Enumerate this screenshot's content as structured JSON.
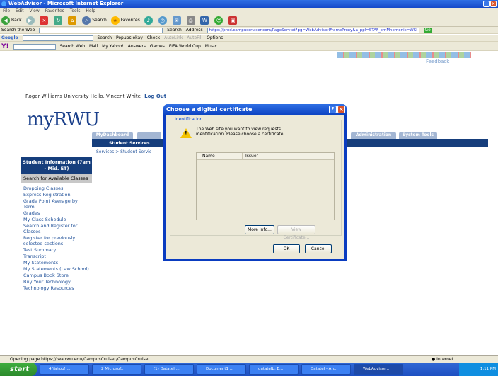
{
  "window": {
    "title": "WebAdvisor - Microsoft Internet Explorer"
  },
  "menu": [
    "File",
    "Edit",
    "View",
    "Favorites",
    "Tools",
    "Help"
  ],
  "toolbar": {
    "back": "Back",
    "search": "Search",
    "favorites": "Favorites"
  },
  "searchbar": {
    "label": "Search the Web",
    "search_btn": "Search",
    "address_label": "Address",
    "url": "https://prod.campuscruiser.com/PageServlet?pg=WebAdvisorIFrameProxy&a_ppl=STAF_cmMnemonic=WSI",
    "go": "Go"
  },
  "googlebar": {
    "logo": "Google",
    "search": "Search",
    "popups": "Popups okay",
    "check": "Check",
    "autolink": "AutoLink",
    "autofill": "AutoFill",
    "options": "Options"
  },
  "yahoobar": {
    "logo": "Y!",
    "search_web": "Search Web",
    "mail": "Mail",
    "my_yahoo": "My Yahoo!",
    "answers": "Answers",
    "games": "Games",
    "fifa": "FIFA World Cup",
    "music": "Music"
  },
  "header": {
    "university": "Roger Williams University",
    "greeting": "Hello, Vincent White",
    "logout": "Log Out",
    "feedback": "Feedback",
    "logo": "myRWU"
  },
  "tabs": [
    "MyDashboard",
    "Administration",
    "System Tools"
  ],
  "subbar": {
    "student_services": "Student Services",
    "breadcrumb": "Services > Student Servic"
  },
  "sidebar": {
    "heading": "Student Information (7am - Mid. ET)",
    "selected": "Search for Available Classes",
    "links": [
      "Dropping Classes",
      "Express Registration",
      "Grade Point Average by Term",
      "Grades",
      "My Class Schedule",
      "Search and Register for Classes",
      "Register for previously selected sections",
      "Test Summary",
      "Transcript",
      "My Statements",
      "My Statements (Law School)",
      "Campus Book Store",
      "Buy Your Technology",
      "Technology Resources"
    ]
  },
  "dialog": {
    "title": "Choose a digital certificate",
    "group": "Identification",
    "message": "The Web site you want to view requests identification. Please choose a certificate.",
    "col_name": "Name",
    "col_issuer": "Issuer",
    "more_info": "More Info...",
    "view_cert": "View Certificate...",
    "ok": "OK",
    "cancel": "Cancel"
  },
  "status": {
    "text": "Opening page https://iwa.rwu.edu/CampusCruiser/CampusCruiser...",
    "zone": "Internet"
  },
  "taskbar": {
    "start": "start",
    "tasks": [
      "4 Yahoo! ...",
      "2 Microsof...",
      "(1) Datatel ...",
      "Document1 ...",
      "datatelb: E...",
      "Datatel - An...",
      "WebAdvisor..."
    ],
    "clock": "1:11 PM"
  },
  "colors": {
    "xp_blue": "#0a3cc0",
    "nav_dark": "#163e7c",
    "link": "#27569c",
    "logo": "#1a3f8a"
  }
}
